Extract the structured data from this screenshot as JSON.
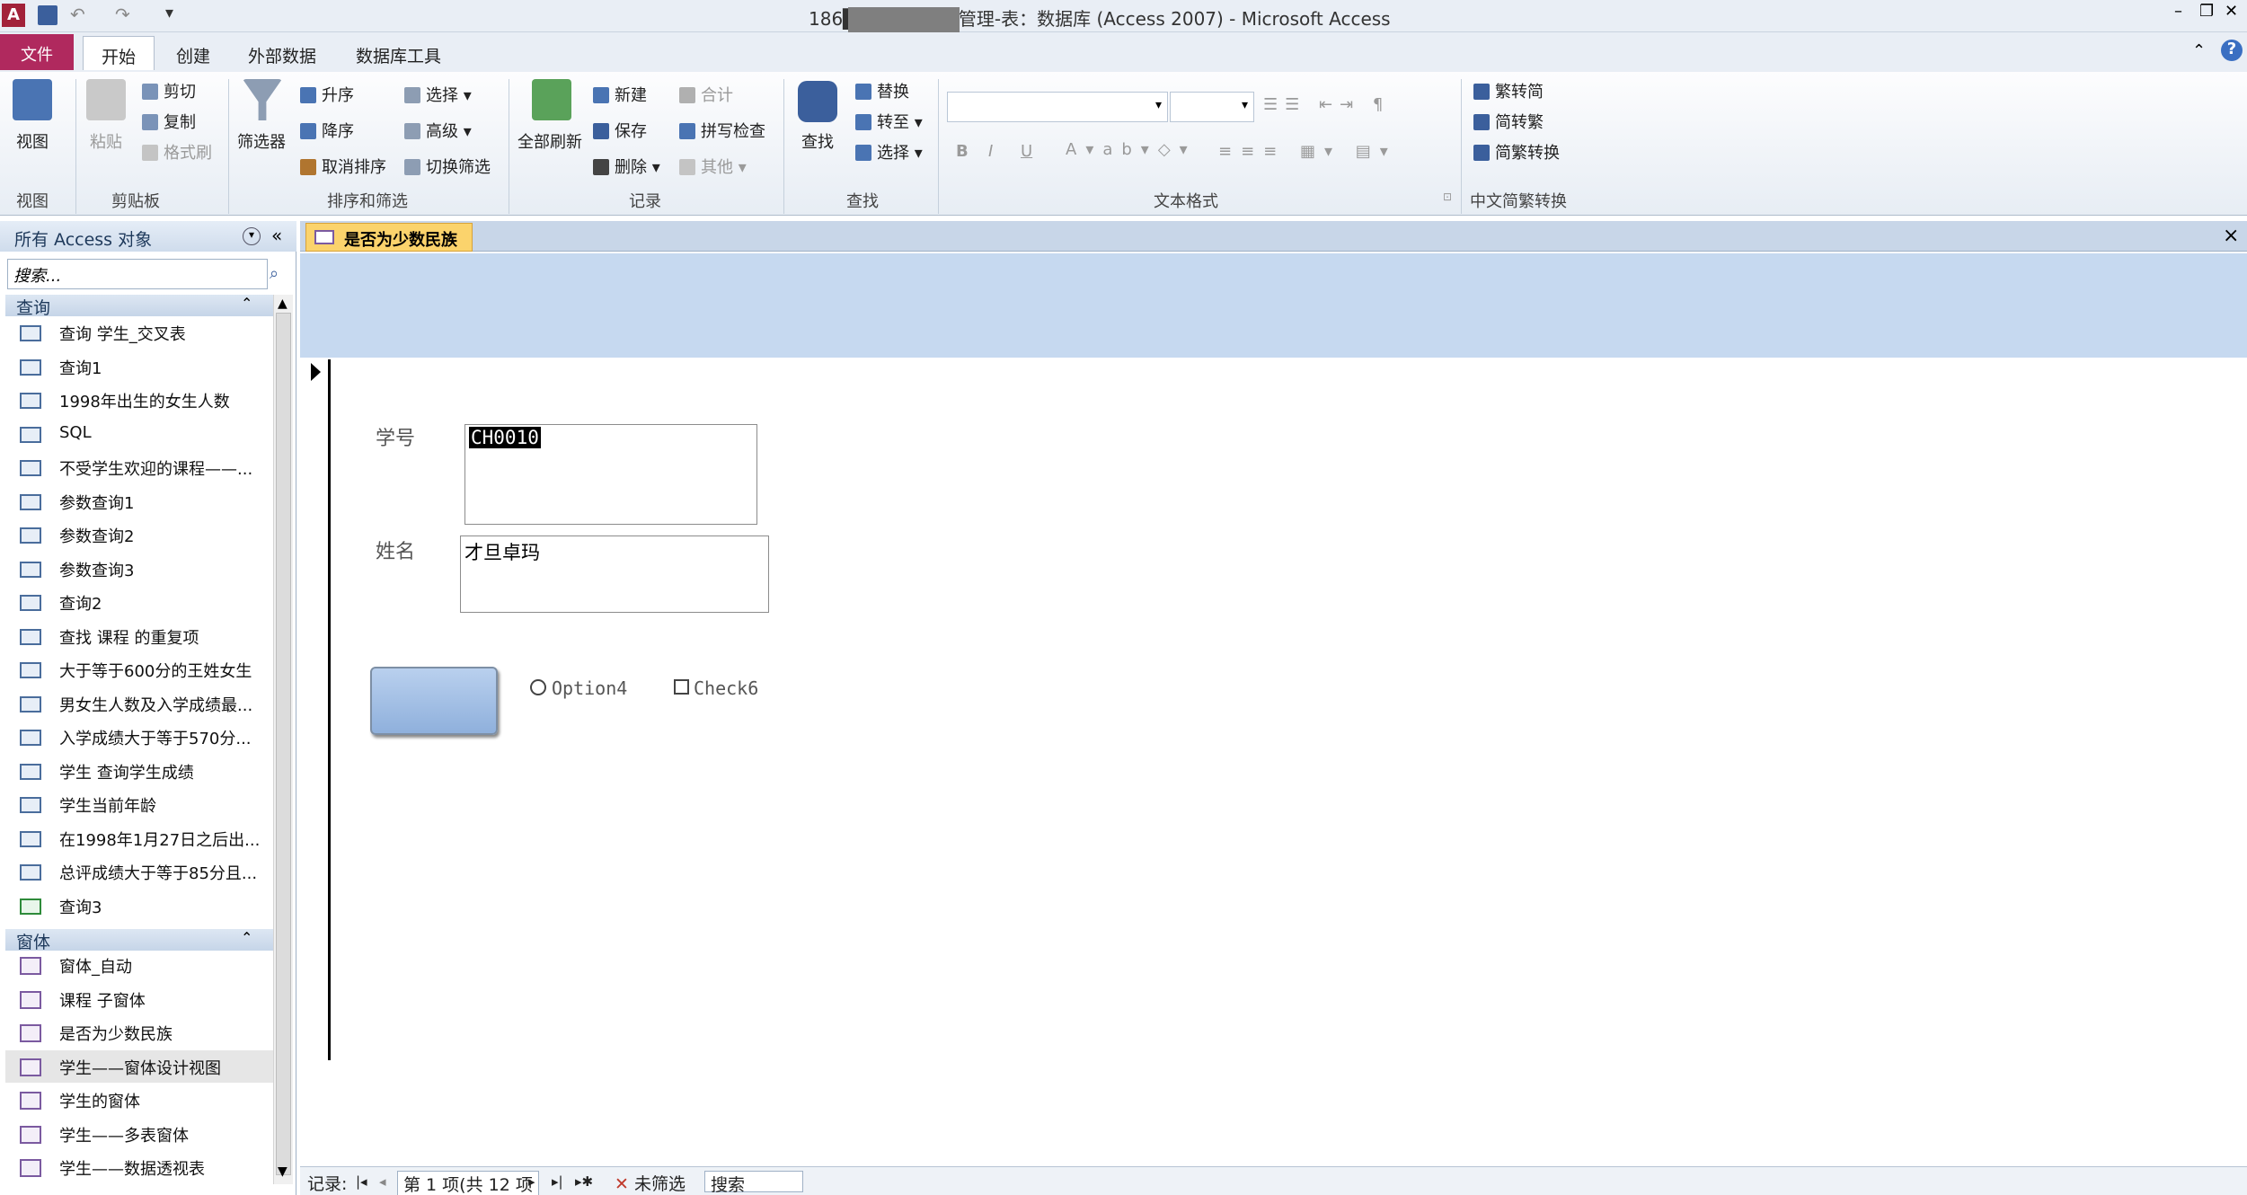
{
  "window": {
    "title": "186████宁-教学管理-表：数据库 (Access 2007) - Microsoft Access",
    "controls": [
      "–",
      "❐",
      "✕"
    ]
  },
  "quick_access": {
    "items": [
      "save-icon",
      "undo-icon",
      "redo-icon",
      "customize-icon"
    ]
  },
  "tabs": [
    {
      "label": "文件"
    },
    {
      "label": "开始"
    },
    {
      "label": "创建"
    },
    {
      "label": "外部数据"
    },
    {
      "label": "数据库工具"
    }
  ],
  "ribbon": {
    "view": {
      "label": "视图",
      "group": "视图"
    },
    "clipboard": {
      "paste": "粘贴",
      "cut": "剪切",
      "copy": "复制",
      "format_painter": "格式刷",
      "group": "剪贴板"
    },
    "sort_filter": {
      "filter": "筛选器",
      "asc": "升序",
      "desc": "降序",
      "remove_sort": "取消排序",
      "selection": "选择",
      "advanced": "高级",
      "toggle_filter": "切换筛选",
      "group": "排序和筛选"
    },
    "records": {
      "refresh_all": "全部刷新",
      "new": "新建",
      "save": "保存",
      "delete": "删除",
      "totals": "合计",
      "spelling": "拼写检查",
      "more": "其他",
      "group": "记录"
    },
    "find": {
      "find": "查找",
      "replace": "替换",
      "goto": "转至",
      "select": "选择",
      "group": "查找"
    },
    "text_format": {
      "group": "文本格式",
      "bold": "B",
      "italic": "I",
      "underline": "U"
    },
    "chinese_conv": {
      "t2s": "繁转简",
      "s2t": "简转繁",
      "conv": "简繁转换",
      "group": "中文简繁转换"
    }
  },
  "nav_pane": {
    "title": "所有 Access 对象",
    "search_placeholder": "搜索...",
    "sections": [
      {
        "name": "查询",
        "items": [
          "查询 学生_交叉表",
          "查询1",
          "1998年出生的女生人数",
          "SQL",
          "不受学生欢迎的课程——...",
          "参数查询1",
          "参数查询2",
          "参数查询3",
          "查询2",
          "查找 课程 的重复项",
          "大于等于600分的王姓女生",
          "男女生人数及入学成绩最...",
          "入学成绩大于等于570分...",
          "学生 查询学生成绩",
          "学生当前年龄",
          "在1998年1月27日之后出...",
          "总评成绩大于等于85分且...",
          "查询3"
        ]
      },
      {
        "name": "窗体",
        "items": [
          "窗体_自动",
          "课程 子窗体",
          "是否为少数民族",
          "学生——窗体设计视图",
          "学生的窗体",
          "学生——多表窗体",
          "学生——数据透视表"
        ]
      }
    ],
    "selected_item": "学生——窗体设计视图"
  },
  "document": {
    "tab_title": "是否为少数民族",
    "close": "×",
    "fields": [
      {
        "label": "学号",
        "value": "CH0010"
      },
      {
        "label": "姓名",
        "value": "才旦卓玛"
      }
    ],
    "option_label": "Option4",
    "check_label": "Check6"
  },
  "record_nav": {
    "label": "记录:",
    "position": "第 1 项(共 12 项",
    "filter": "未筛选",
    "search": "搜索"
  }
}
